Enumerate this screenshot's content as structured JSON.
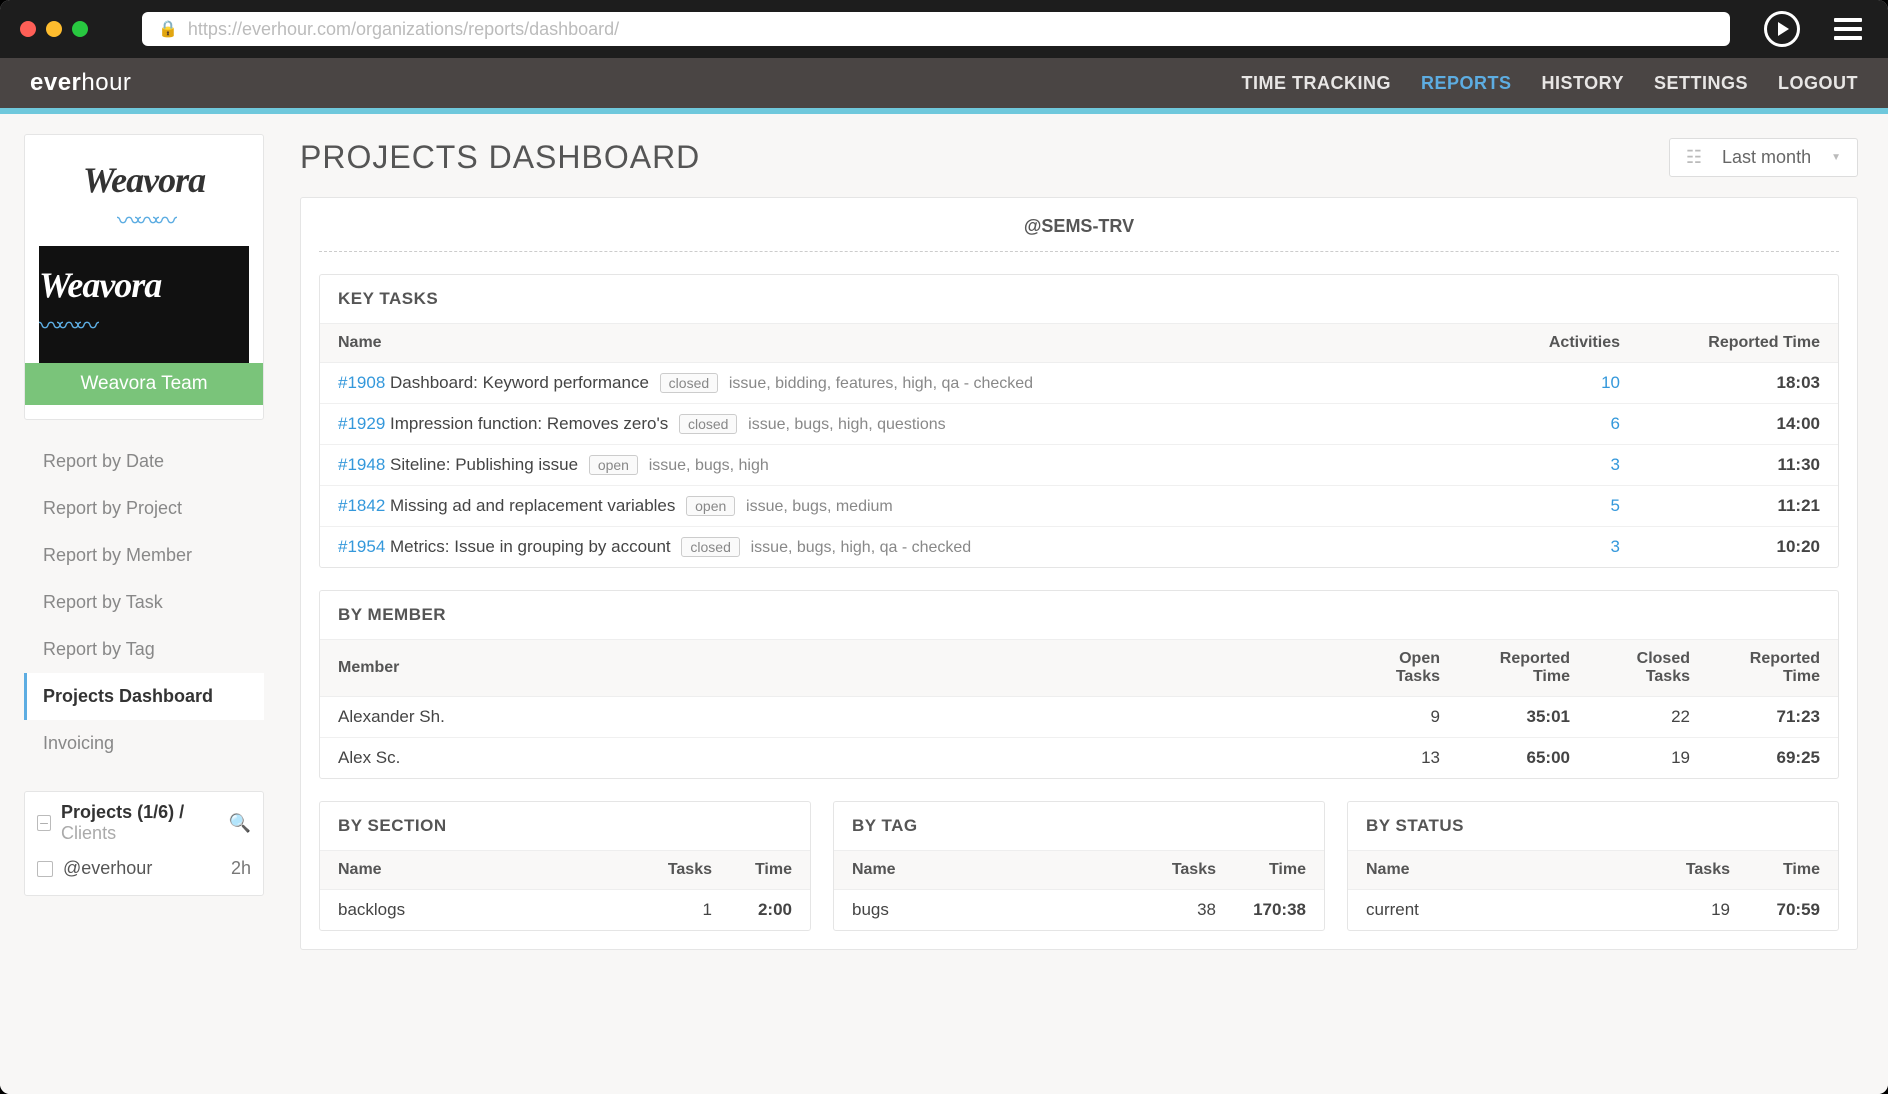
{
  "browser": {
    "url": "https://everhour.com/organizations/reports/dashboard/"
  },
  "topnav": {
    "logo_bold": "ever",
    "logo_light": "hour",
    "links": [
      "TIME TRACKING",
      "REPORTS",
      "HISTORY",
      "SETTINGS",
      "LOGOUT"
    ],
    "active_index": 1
  },
  "sidebar": {
    "org_name": "Weavora",
    "team_badge": "Weavora Team",
    "items": [
      "Report by Date",
      "Report by Project",
      "Report by Member",
      "Report by Task",
      "Report by Tag",
      "Projects Dashboard",
      "Invoicing"
    ],
    "active_index": 5,
    "filter": {
      "header_bold": "Projects (1/6) / ",
      "header_light": "Clients",
      "rows": [
        {
          "name": "@everhour",
          "hours": "2h"
        }
      ]
    }
  },
  "page": {
    "title": "PROJECTS DASHBOARD",
    "date_range": "Last month",
    "project_handle": "@SEMS-TRV"
  },
  "key_tasks": {
    "title": "KEY TASKS",
    "cols": [
      "Name",
      "Activities",
      "Reported Time"
    ],
    "rows": [
      {
        "id": "#1908",
        "name": "Dashboard: Keyword performance",
        "status": "closed",
        "tags": "issue,  bidding,  features,  high,  qa - checked",
        "activities": "10",
        "time": "18:03"
      },
      {
        "id": "#1929",
        "name": "Impression function: Removes zero's",
        "status": "closed",
        "tags": "issue,  bugs,  high,  questions",
        "activities": "6",
        "time": "14:00"
      },
      {
        "id": "#1948",
        "name": "Siteline: Publishing issue",
        "status": "open",
        "tags": "issue,  bugs,  high",
        "activities": "3",
        "time": "11:30"
      },
      {
        "id": "#1842",
        "name": "Missing ad and replacement variables",
        "status": "open",
        "tags": "issue,  bugs,  medium",
        "activities": "5",
        "time": "11:21"
      },
      {
        "id": "#1954",
        "name": "Metrics: Issue in grouping by account",
        "status": "closed",
        "tags": "issue,  bugs,  high,  qa - checked",
        "activities": "3",
        "time": "10:20"
      }
    ]
  },
  "by_member": {
    "title": "BY MEMBER",
    "cols": [
      "Member",
      "Open Tasks",
      "Reported Time",
      "Closed Tasks",
      "Reported Time"
    ],
    "rows": [
      {
        "name": "Alexander Sh.",
        "open": "9",
        "rt1": "35:01",
        "closed": "22",
        "rt2": "71:23"
      },
      {
        "name": "Alex Sc.",
        "open": "13",
        "rt1": "65:00",
        "closed": "19",
        "rt2": "69:25"
      }
    ]
  },
  "by_section": {
    "title": "BY SECTION",
    "cols": [
      "Name",
      "Tasks",
      "Time"
    ],
    "rows": [
      {
        "name": "backlogs",
        "tasks": "1",
        "time": "2:00"
      }
    ]
  },
  "by_tag": {
    "title": "BY TAG",
    "cols": [
      "Name",
      "Tasks",
      "Time"
    ],
    "rows": [
      {
        "name": "bugs",
        "tasks": "38",
        "time": "170:38"
      }
    ]
  },
  "by_status": {
    "title": "BY STATUS",
    "cols": [
      "Name",
      "Tasks",
      "Time"
    ],
    "rows": [
      {
        "name": "current",
        "tasks": "19",
        "time": "70:59"
      }
    ]
  }
}
